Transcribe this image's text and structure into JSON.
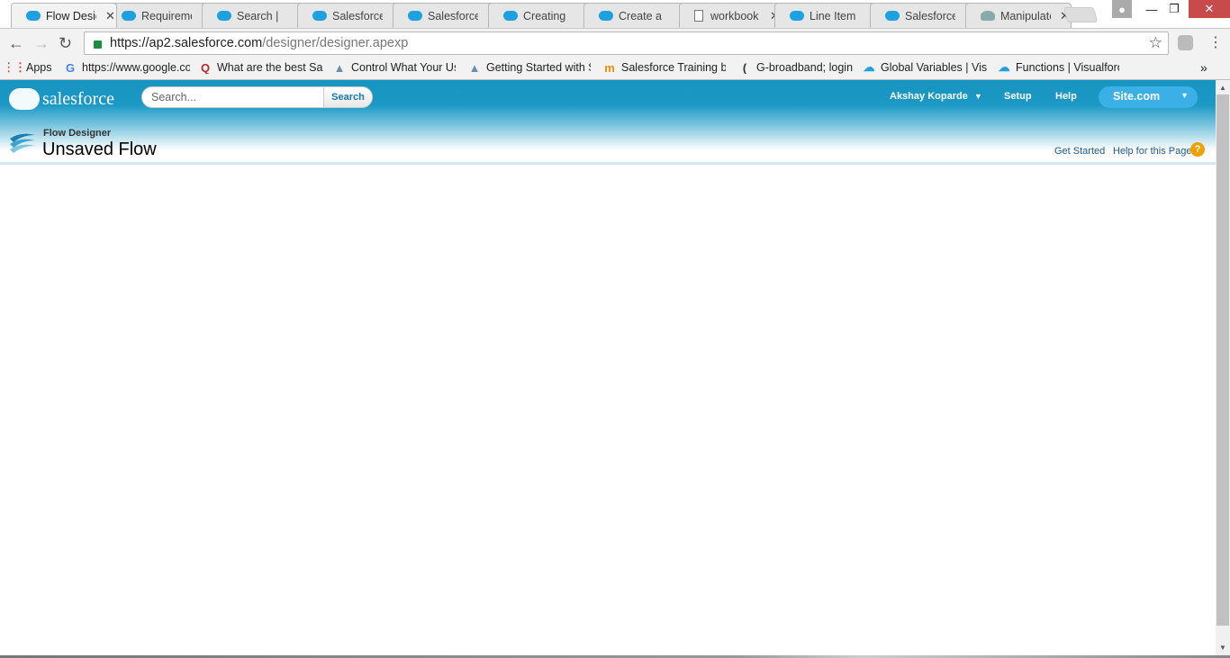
{
  "browser": {
    "tabs": [
      {
        "label": "Flow Designer",
        "icon": "salesforce-cloud-icon",
        "active": true
      },
      {
        "label": "Requirements",
        "icon": "salesforce-cloud-icon"
      },
      {
        "label": "Search |",
        "icon": "salesforce-cloud-icon"
      },
      {
        "label": "Salesforce",
        "icon": "salesforce-cloud-icon"
      },
      {
        "label": "Salesforce",
        "icon": "salesforce-cloud-icon"
      },
      {
        "label": "Creating",
        "icon": "salesforce-cloud-icon"
      },
      {
        "label": "Create a",
        "icon": "salesforce-cloud-icon"
      },
      {
        "label": "workbook",
        "icon": "document-icon"
      },
      {
        "label": "Line Item",
        "icon": "salesforce-cloud-icon"
      },
      {
        "label": "Salesforce",
        "icon": "salesforce-cloud-icon"
      },
      {
        "label": "Manipulate",
        "icon": "trailhead-icon"
      }
    ],
    "close_glyph": "✕",
    "url_host": "https://ap2.salesforce.com",
    "url_path": "/designer/designer.apexp",
    "bookmarks": [
      {
        "label": "Apps",
        "icon": "apps-grid-icon"
      },
      {
        "label": "https://www.google.com",
        "icon": "google-icon"
      },
      {
        "label": "What are the best Sales",
        "icon": "quora-icon"
      },
      {
        "label": "Control What Your Users",
        "icon": "trailhead-icon"
      },
      {
        "label": "Getting Started with S",
        "icon": "trailhead-icon"
      },
      {
        "label": "Salesforce Training by",
        "icon": "mindmajix-icon"
      },
      {
        "label": "G-broadband; login",
        "icon": "broadband-icon"
      },
      {
        "label": "Global Variables | Visualforce",
        "icon": "salesforce-cloud-icon"
      },
      {
        "label": "Functions | Visualforce",
        "icon": "salesforce-cloud-icon"
      }
    ],
    "more_bookmarks": "»"
  },
  "header": {
    "logo_text": "salesforce",
    "search_placeholder": "Search...",
    "search_button": "Search",
    "user_name": "Akshay Koparde",
    "setup": "Setup",
    "help": "Help",
    "app_switcher": "Site.com"
  },
  "page": {
    "type": "Flow Designer",
    "title": "Unsaved Flow",
    "get_started": "Get Started",
    "help_for_page": "Help for this Page"
  },
  "colors": {
    "header_blue": "#1894c0",
    "site_button": "#3bb0e6",
    "link": "#1a5a96"
  }
}
